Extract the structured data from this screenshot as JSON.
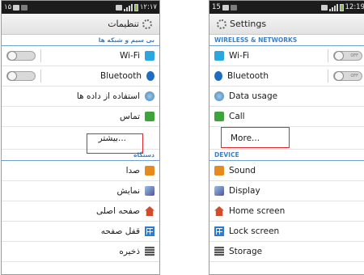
{
  "left_phone": {
    "status_time": "۱۲:۱۷",
    "status_left": "۱۵",
    "title": "تنظیمات",
    "section_wireless": "بی سیم و شبکه ها",
    "wifi": "Wi-Fi",
    "bluetooth": "Bluetooth",
    "data_usage": "استفاده از داده ها",
    "call": "تماس",
    "more": "بیشتر...",
    "section_device": "دستگاه",
    "sound": "صدا",
    "display": "نمایش",
    "home_screen": "صفحه اصلی",
    "lock_screen": "قفل صفحه",
    "storage": "ذخیره"
  },
  "right_phone": {
    "status_time": "12:19",
    "status_left": "15",
    "title": "Settings",
    "section_wireless": "WIRELESS & NETWORKS",
    "wifi": "Wi-Fi",
    "bluetooth": "Bluetooth",
    "data_usage": "Data usage",
    "call": "Call",
    "more": "More...",
    "section_device": "DEVICE",
    "sound": "Sound",
    "display": "Display",
    "home_screen": "Home screen",
    "lock_screen": "Lock screen",
    "storage": "Storage"
  },
  "toggle_off_label": "OFF",
  "highlight_color": "#e0252b",
  "accent_color": "#3a7fc7"
}
